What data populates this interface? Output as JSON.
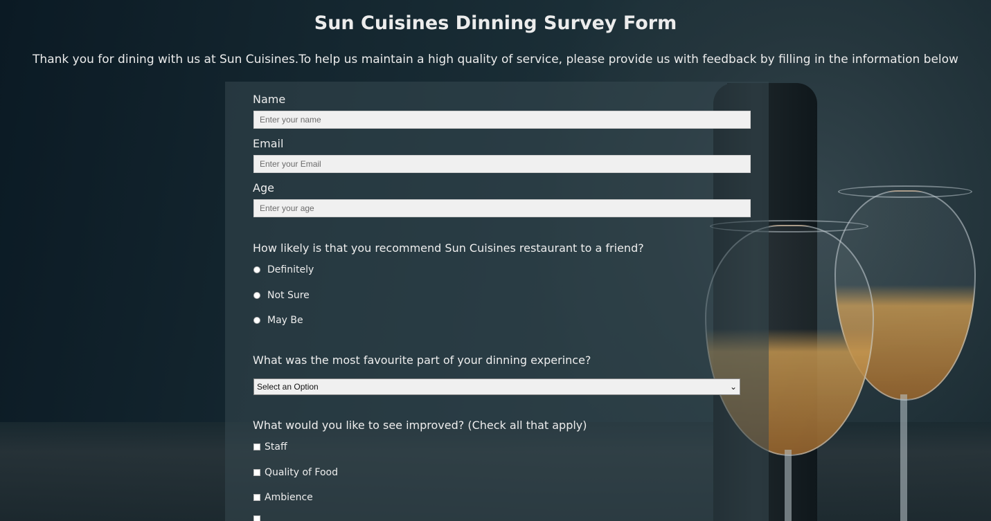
{
  "header": {
    "title": "Sun Cuisines Dinning Survey Form",
    "description": "Thank you for dining with us at Sun Cuisines.To help us maintain a high quality of service, please provide us with feedback by filling in the information below"
  },
  "form": {
    "name": {
      "label": "Name",
      "placeholder": "Enter your name"
    },
    "email": {
      "label": "Email",
      "placeholder": "Enter your Email"
    },
    "age": {
      "label": "Age",
      "placeholder": "Enter your age"
    },
    "recommend": {
      "question": "How likely is that you recommend Sun Cuisines restaurant to a friend?",
      "options": [
        "Definitely",
        "Not Sure",
        "May Be"
      ]
    },
    "favourite": {
      "question": "What was the most favourite part of your dinning experince?",
      "selected": "Select an Option"
    },
    "improve": {
      "question": "What would you like to see improved? (Check all that apply)",
      "options": [
        "Staff",
        "Quality of Food",
        "Ambience"
      ]
    }
  },
  "icons": {
    "select_arrow": "chevron-down-icon"
  }
}
